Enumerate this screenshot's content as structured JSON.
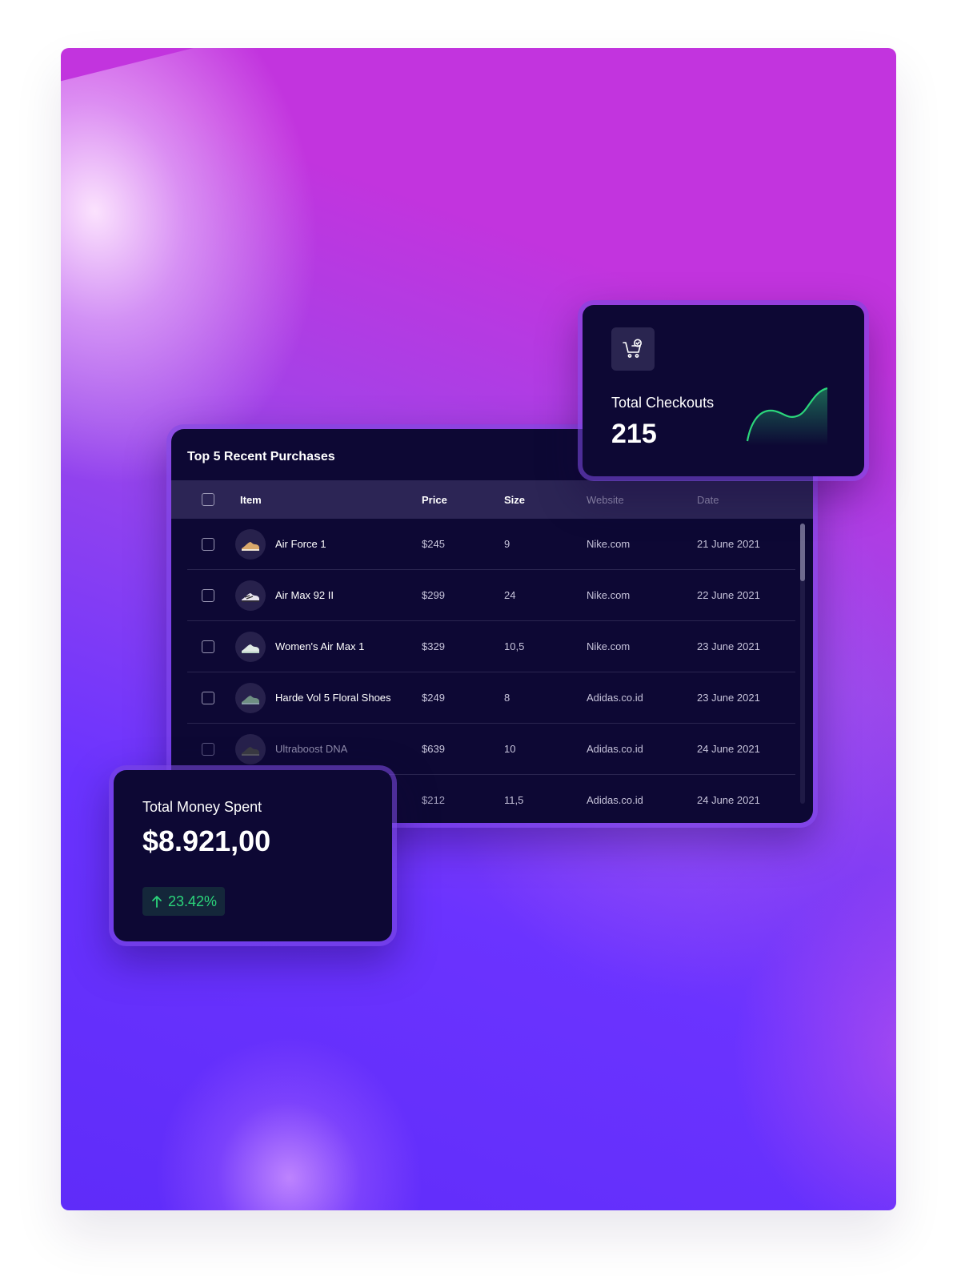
{
  "table": {
    "title": "Top 5 Recent Purchases",
    "columns": [
      "Item",
      "Price",
      "Size",
      "Website",
      "Date"
    ],
    "rows": [
      {
        "item": "Air Force 1",
        "price": "$245",
        "size": "9",
        "website": "Nike.com",
        "date": "21 June 2021",
        "icon": "sneaker-icon"
      },
      {
        "item": "Air Max 92 II",
        "price": "$299",
        "size": "24",
        "website": "Nike.com",
        "date": "22 June 2021",
        "icon": "sneaker-icon"
      },
      {
        "item": "Women's Air Max 1",
        "price": "$329",
        "size": "10,5",
        "website": "Nike.com",
        "date": "23 June 2021",
        "icon": "sneaker-icon"
      },
      {
        "item": "Harde Vol 5 Floral Shoes",
        "price": "$249",
        "size": "8",
        "website": "Adidas.co.id",
        "date": "23 June 2021",
        "icon": "sneaker-icon"
      },
      {
        "item": "Ultraboost DNA",
        "price": "$639",
        "size": "10",
        "website": "Adidas.co.id",
        "date": "24 June 2021",
        "icon": "sneaker-icon"
      },
      {
        "item": "",
        "price": "$212",
        "size": "11,5",
        "website": "Adidas.co.id",
        "date": "24 June 2021",
        "icon": "sneaker-icon"
      }
    ]
  },
  "checkouts": {
    "label": "Total Checkouts",
    "value": "215",
    "icon": "cart-check-icon",
    "line_color": "#2bd67b"
  },
  "money": {
    "label": "Total Money Spent",
    "value": "$8.921,00",
    "delta": "23.42%",
    "delta_icon": "arrow-up-icon",
    "delta_color": "#2bd67b"
  }
}
